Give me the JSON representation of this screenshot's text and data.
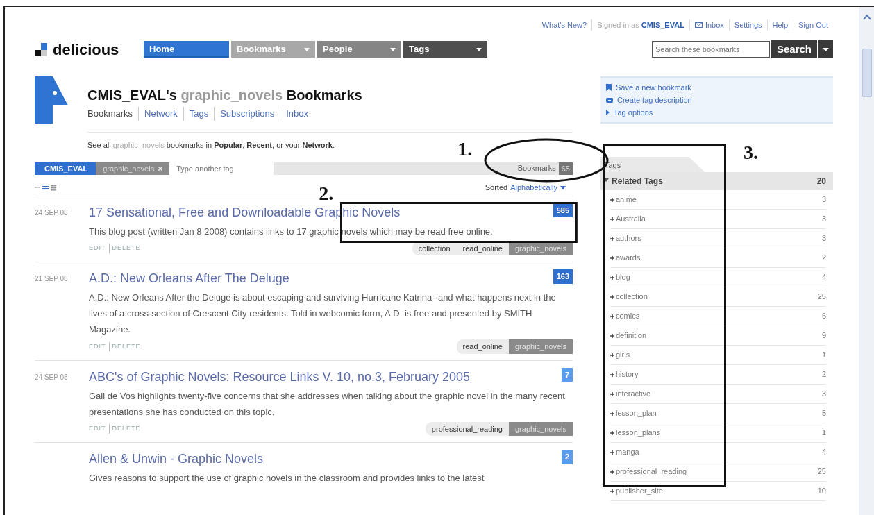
{
  "top_links": [
    {
      "kind": "link",
      "label": "What's New?"
    },
    {
      "kind": "signed",
      "label": "Signed in as",
      "user": "CMIS_EVAL"
    },
    {
      "kind": "inbox",
      "label": "Inbox"
    },
    {
      "kind": "link",
      "label": "Settings"
    },
    {
      "kind": "link",
      "label": "Help"
    },
    {
      "kind": "link",
      "label": "Sign Out"
    }
  ],
  "logo": "delicious",
  "nav": [
    {
      "label": "Home",
      "selected": true,
      "dropdown": false,
      "color": "#2f74d0"
    },
    {
      "label": "Bookmarks",
      "selected": false,
      "dropdown": true,
      "color": "#a8a8a8"
    },
    {
      "label": "People",
      "selected": false,
      "dropdown": true,
      "color": "#858585"
    },
    {
      "label": "Tags",
      "selected": false,
      "dropdown": true,
      "color": "#4e4e4e"
    }
  ],
  "search": {
    "placeholder": "Search these bookmarks",
    "button": "Search"
  },
  "header": {
    "owner": "CMIS_EVAL's",
    "tag": "graphic_novels",
    "suffix": "Bookmarks"
  },
  "subnav": [
    {
      "label": "Bookmarks",
      "selected": true
    },
    {
      "label": "Network",
      "selected": false
    },
    {
      "label": "Tags",
      "selected": false
    },
    {
      "label": "Subscriptions",
      "selected": false
    },
    {
      "label": "Inbox",
      "selected": false
    }
  ],
  "see_all": [
    {
      "kind": "text",
      "text": "See all"
    },
    {
      "kind": "tag",
      "text": "graphic_novels"
    },
    {
      "kind": "text",
      "text": "bookmarks in"
    },
    {
      "kind": "link",
      "text": "Popular"
    },
    {
      "kind": "text",
      "text": ","
    },
    {
      "kind": "link",
      "text": "Recent"
    },
    {
      "kind": "text",
      "text": ", or your"
    },
    {
      "kind": "link",
      "text": "Network"
    },
    {
      "kind": "text",
      "text": "."
    }
  ],
  "tag_bar": {
    "user": "CMIS_EVAL",
    "tag": "graphic_novels",
    "placeholder": "Type another tag",
    "count_label": "Bookmarks",
    "count": "65"
  },
  "sort": {
    "label": "Sorted",
    "value": "Alphabetically"
  },
  "bookmarks": [
    {
      "date": "24 SEP 08",
      "title": "17 Sensational, Free and Downloadable Graphic Novels",
      "description": "This blog post (written Jan 8 2008) contains links to 17 graphic novels which may be read free online.",
      "count": "585",
      "color": "#2f6fd0",
      "edit": "EDIT",
      "delete": "DELETE",
      "tags": [
        {
          "name": "collection",
          "selected": false
        },
        {
          "name": "read_online",
          "selected": false
        },
        {
          "name": "graphic_novels",
          "selected": true
        }
      ]
    },
    {
      "date": "21 SEP 08",
      "title": "A.D.: New Orleans After The Deluge",
      "description": "A.D.: New Orleans After the Deluge is about escaping and surviving Hurricane Katrina--and what happens next in the lives of a cross-section of Crescent City residents. Told in webcomic form, A.D. is free and presented by SMITH Magazine.",
      "count": "163",
      "color": "#2f6fd0",
      "edit": "EDIT",
      "delete": "DELETE",
      "tags": [
        {
          "name": "read_online",
          "selected": false
        },
        {
          "name": "graphic_novels",
          "selected": true
        }
      ]
    },
    {
      "date": "24 SEP 08",
      "title": "ABC's of Graphic Novels: Resource Links V. 10, no.3, February 2005",
      "description": "Gail de Vos highlights twenty-five concerns that she addresses when talking about the graphic novel in the many recent presentations she has conducted on this topic.",
      "count": "7",
      "color": "#5b9bec",
      "edit": "EDIT",
      "delete": "DELETE",
      "tags": [
        {
          "name": "professional_reading",
          "selected": false
        },
        {
          "name": "graphic_novels",
          "selected": true
        }
      ]
    },
    {
      "title": "Allen & Unwin - Graphic Novels",
      "description": "Gives reasons to support the use of graphic novels in the classroom and provides links to the latest",
      "count": "2",
      "color": "#5b9bec"
    }
  ],
  "actions": [
    {
      "kind": "bookmark",
      "label": "Save a new bookmark"
    },
    {
      "kind": "describe",
      "label": "Create tag description"
    },
    {
      "kind": "options",
      "label": "Tag options"
    }
  ],
  "sidebar": {
    "tab": "Tags",
    "section": "Related Tags",
    "count": "20",
    "expanded": true,
    "tags": [
      {
        "name": "anime",
        "count": "3"
      },
      {
        "name": "Australia",
        "count": "3"
      },
      {
        "name": "authors",
        "count": "3"
      },
      {
        "name": "awards",
        "count": "2"
      },
      {
        "name": "blog",
        "count": "4"
      },
      {
        "name": "collection",
        "count": "25"
      },
      {
        "name": "comics",
        "count": "6"
      },
      {
        "name": "definition",
        "count": "9"
      },
      {
        "name": "girls",
        "count": "1"
      },
      {
        "name": "history",
        "count": "2"
      },
      {
        "name": "interactive",
        "count": "3"
      },
      {
        "name": "lesson_plan",
        "count": "5"
      },
      {
        "name": "lesson_plans",
        "count": "1"
      },
      {
        "name": "manga",
        "count": "4"
      },
      {
        "name": "professional_reading",
        "count": "25"
      },
      {
        "name": "publisher_site",
        "count": "10"
      }
    ]
  },
  "annotations": [
    {
      "label": "1.",
      "kind": "ellipse"
    },
    {
      "label": "2.",
      "kind": "rect"
    },
    {
      "label": "3.",
      "kind": "rect"
    }
  ]
}
